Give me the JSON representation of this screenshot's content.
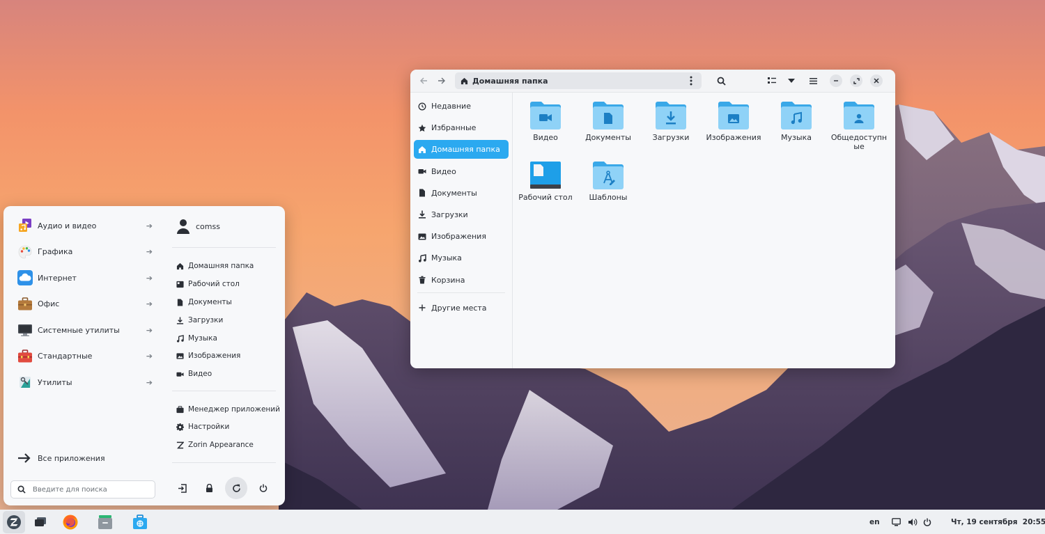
{
  "file_manager": {
    "path": "Домашняя папка",
    "sidebar": [
      {
        "icon": "clock-icon",
        "label": "Недавние"
      },
      {
        "icon": "star-icon",
        "label": "Избранные"
      },
      {
        "icon": "home-icon",
        "label": "Домашняя папка",
        "active": true
      },
      {
        "icon": "video-icon",
        "label": "Видео"
      },
      {
        "icon": "document-icon",
        "label": "Документы"
      },
      {
        "icon": "download-icon",
        "label": "Загрузки"
      },
      {
        "icon": "image-icon",
        "label": "Изображения"
      },
      {
        "icon": "music-icon",
        "label": "Музыка"
      },
      {
        "icon": "trash-icon",
        "label": "Корзина"
      }
    ],
    "other_places": "Другие места",
    "folders": [
      {
        "name": "Видео",
        "emblem": "video"
      },
      {
        "name": "Документы",
        "emblem": "document"
      },
      {
        "name": "Загрузки",
        "emblem": "download"
      },
      {
        "name": "Изображения",
        "emblem": "image"
      },
      {
        "name": "Музыка",
        "emblem": "music"
      },
      {
        "name": "Общедоступные",
        "emblem": "user"
      },
      {
        "name": "Рабочий стол",
        "emblem": "desktop"
      },
      {
        "name": "Шаблоны",
        "emblem": "templates"
      }
    ]
  },
  "start_menu": {
    "categories": [
      {
        "icon": "audio-video-icon",
        "label": "Аудио и видео"
      },
      {
        "icon": "graphics-icon",
        "label": "Графика"
      },
      {
        "icon": "internet-icon",
        "label": "Интернет"
      },
      {
        "icon": "office-icon",
        "label": "Офис"
      },
      {
        "icon": "system-tools-icon",
        "label": "Системные утилиты"
      },
      {
        "icon": "accessories-icon",
        "label": "Стандартные"
      },
      {
        "icon": "utilities-icon",
        "label": "Утилиты"
      }
    ],
    "all_apps": "Все приложения",
    "search_placeholder": "Введите для поиска",
    "user": "comss",
    "places": [
      {
        "icon": "home-icon",
        "label": "Домашняя папка"
      },
      {
        "icon": "desktop-icon",
        "label": "Рабочий стол"
      },
      {
        "icon": "document-icon",
        "label": "Документы"
      },
      {
        "icon": "download-icon",
        "label": "Загрузки"
      },
      {
        "icon": "music-icon",
        "label": "Музыка"
      },
      {
        "icon": "image-icon",
        "label": "Изображения"
      },
      {
        "icon": "video-icon",
        "label": "Видео"
      }
    ],
    "system": [
      {
        "icon": "briefcase-icon",
        "label": "Менеджер приложений"
      },
      {
        "icon": "gear-icon",
        "label": "Настройки"
      },
      {
        "icon": "zorin-appearance-icon",
        "label": "Zorin Appearance"
      }
    ],
    "power_buttons": [
      "logout-icon",
      "lock-icon",
      "restart-icon",
      "power-icon"
    ]
  },
  "taskbar": {
    "apps": [
      "zorin-menu-icon",
      "workspaces-icon",
      "firefox-icon",
      "files-icon",
      "software-icon"
    ],
    "keyboard_layout": "en",
    "clock": "Чт, 19 сентября  20:55"
  },
  "colors": {
    "accent": "#2ba9f0",
    "folder_light": "#8fd2f7",
    "folder_dark": "#3aa8e8",
    "text": "#2b2f36"
  }
}
